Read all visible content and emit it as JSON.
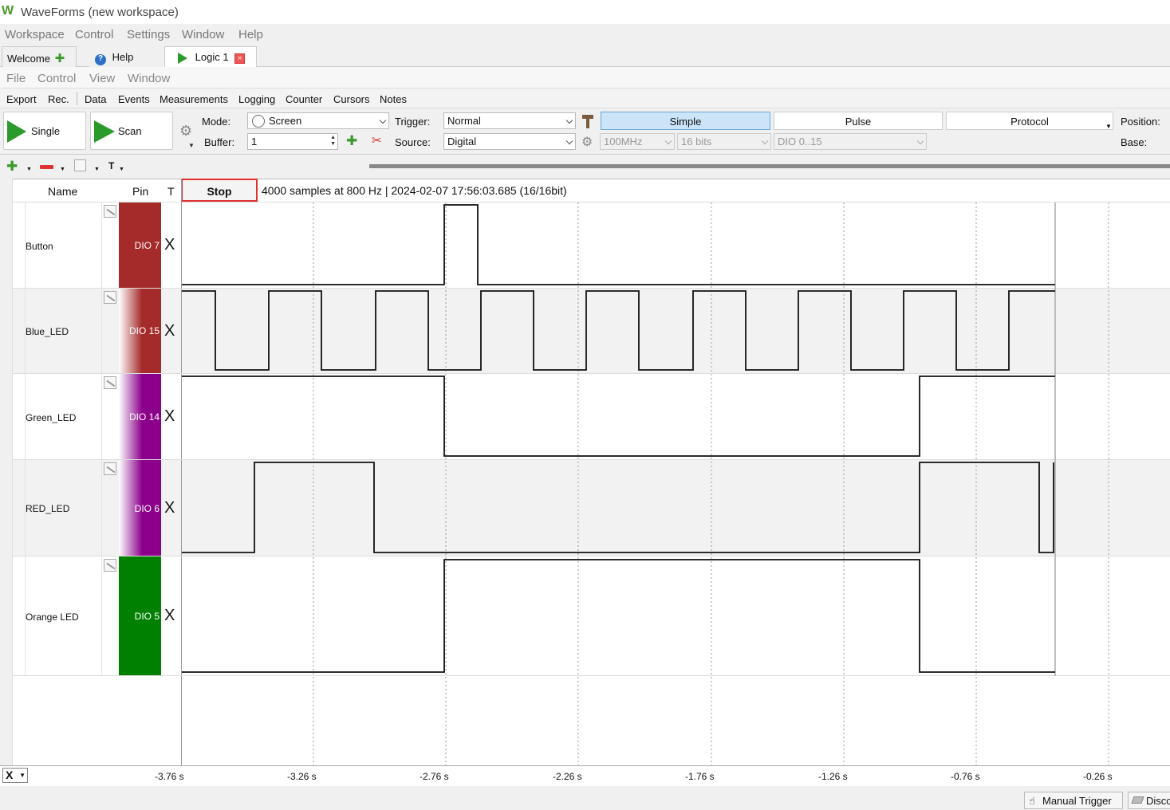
{
  "app": {
    "title": "WaveForms (new workspace)"
  },
  "main_menu": [
    "Workspace",
    "Control",
    "Settings",
    "Window",
    "Help"
  ],
  "tabs": [
    {
      "label": "Welcome"
    },
    {
      "label": "Help"
    },
    {
      "label": "Logic 1"
    }
  ],
  "instrument_menu": [
    "File",
    "Control",
    "View",
    "Window"
  ],
  "toolbar": [
    "Export",
    "Rec.",
    "Data",
    "Events",
    "Measurements",
    "Logging",
    "Counter",
    "Cursors",
    "Notes"
  ],
  "controls": {
    "single_label": "Single",
    "scan_label": "Scan",
    "mode_label": "Mode:",
    "mode_value": "Screen",
    "buffer_label": "Buffer:",
    "buffer_value": "1",
    "trigger_label": "Trigger:",
    "trigger_value": "Normal",
    "source_label": "Source:",
    "source_value": "Digital",
    "rate_value": "100MHz",
    "bits_value": "16 bits",
    "channels_value": "DIO 0..15",
    "mode_tabs": [
      "Simple",
      "Pulse",
      "Protocol"
    ],
    "position_label": "Position:",
    "base_label": "Base:"
  },
  "columns": {
    "name": "Name",
    "pin": "Pin",
    "trigger": "T"
  },
  "stop_label": "Stop",
  "status": "4000 samples at 800 Hz | 2024-02-07 17:56:03.685 (16/16bit)",
  "channels": [
    {
      "name": "Button",
      "pin": "DIO  7",
      "trigger": "X",
      "color": "#a52a2a"
    },
    {
      "name": "Blue_LED",
      "pin": "DIO 15",
      "trigger": "X",
      "color": "#a52a2a"
    },
    {
      "name": "Green_LED",
      "pin": "DIO 14",
      "trigger": "X",
      "color": "#8b008b"
    },
    {
      "name": "RED_LED",
      "pin": "DIO  6",
      "trigger": "X",
      "color": "#8b008b"
    },
    {
      "name": "Orange LED",
      "pin": "DIO  5",
      "trigger": "X",
      "color": "#008000"
    }
  ],
  "x_axis": {
    "unit": "s",
    "ticks": [
      "-3.76 s",
      "-3.26 s",
      "-2.76 s",
      "-2.26 s",
      "-1.76 s",
      "-1.26 s",
      "-0.76 s",
      "-0.26 s"
    ],
    "selector": "X"
  },
  "statusbar": {
    "manual_trigger": "Manual Trigger",
    "disconnect": "Disco"
  }
}
